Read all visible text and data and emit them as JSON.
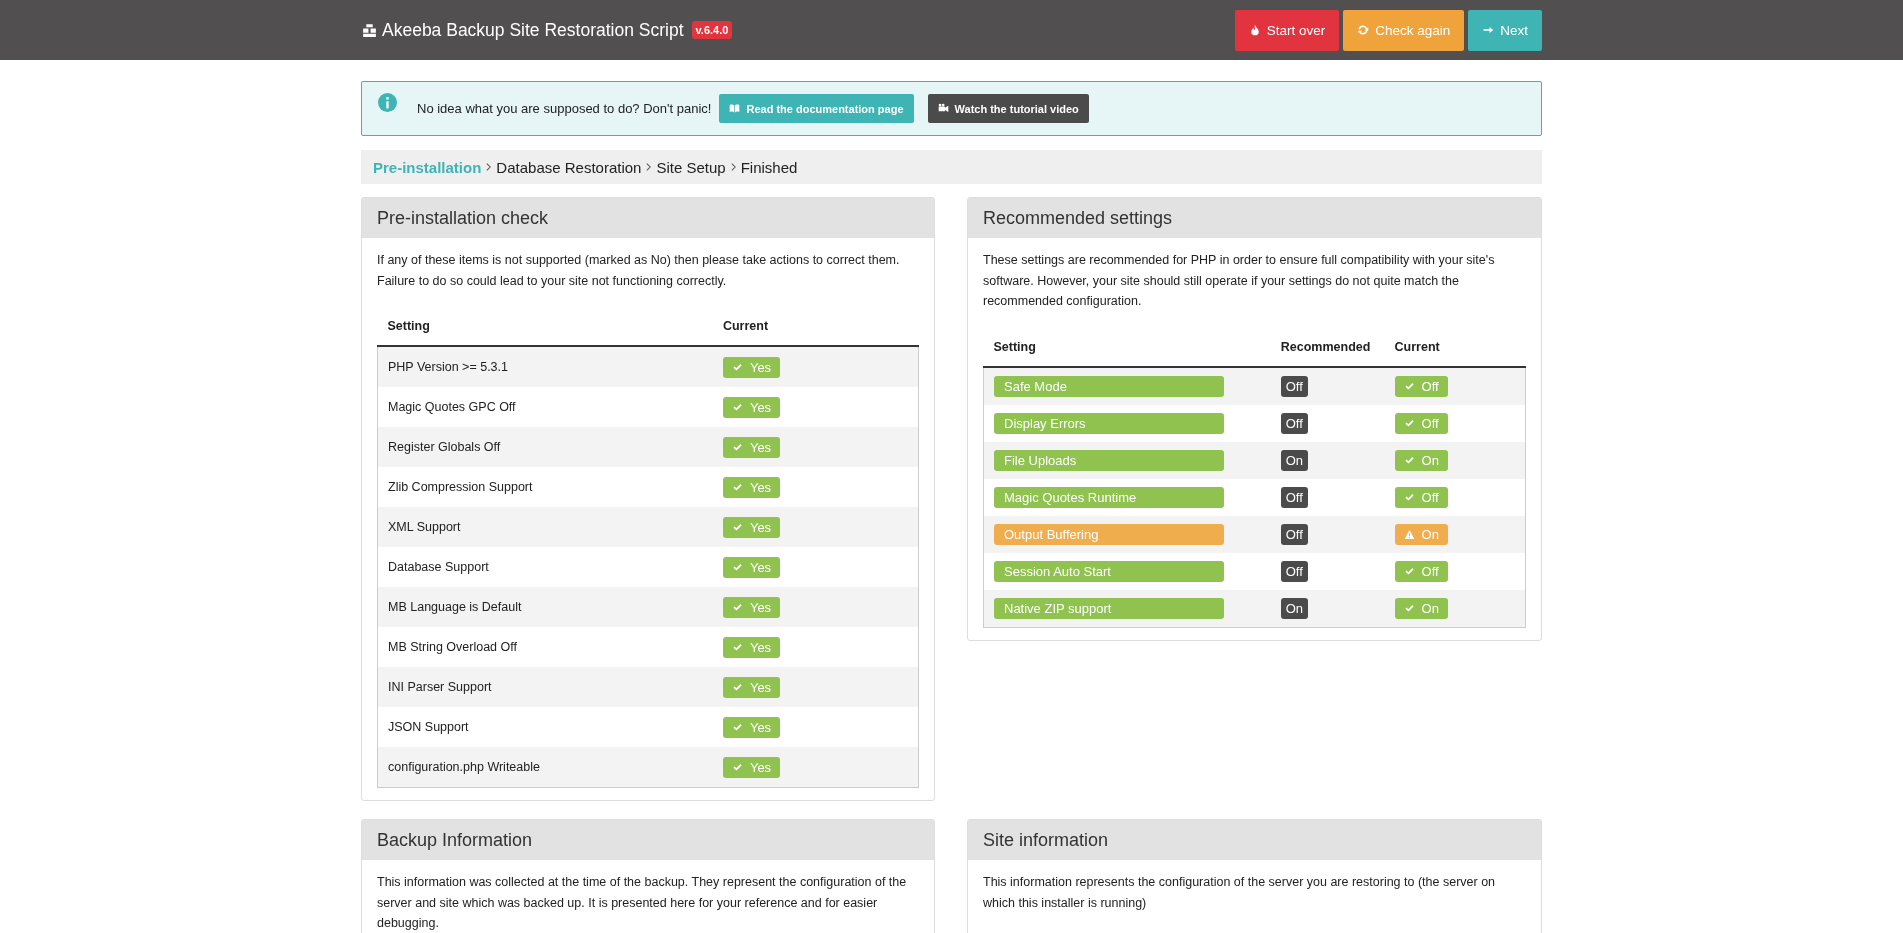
{
  "header": {
    "title": "Akeeba Backup Site Restoration Script",
    "version": "v.6.4.0",
    "buttons": [
      {
        "kind": "danger",
        "label": "Start over"
      },
      {
        "kind": "warning",
        "label": "Check again"
      },
      {
        "kind": "primary",
        "label": "Next"
      }
    ]
  },
  "notice": {
    "text": "No idea what you are supposed to do? Don't panic!",
    "buttons": [
      {
        "kind": "docs",
        "label": "Read the documentation page"
      },
      {
        "kind": "video",
        "label": "Watch the tutorial video"
      }
    ]
  },
  "breadcrumb": [
    {
      "label": "Pre-installation",
      "selected": true
    },
    {
      "label": "Database Restoration",
      "selected": false
    },
    {
      "label": "Site Setup",
      "selected": false
    },
    {
      "label": "Finished",
      "selected": false
    }
  ],
  "preinstall": {
    "title": "Pre-installation check",
    "intro": "If any of these items is not supported (marked as No) then please take actions to correct them. Failure to do so could lead to your site not functioning correctly.",
    "columns": [
      "Setting",
      "Current"
    ],
    "rows": [
      {
        "setting": "PHP Version >= 5.3.1",
        "current": "Yes",
        "kind": "ok"
      },
      {
        "setting": "Magic Quotes GPC Off",
        "current": "Yes",
        "kind": "ok"
      },
      {
        "setting": "Register Globals Off",
        "current": "Yes",
        "kind": "ok"
      },
      {
        "setting": "Zlib Compression Support",
        "current": "Yes",
        "kind": "ok"
      },
      {
        "setting": "XML Support",
        "current": "Yes",
        "kind": "ok"
      },
      {
        "setting": "Database Support",
        "current": "Yes",
        "kind": "ok"
      },
      {
        "setting": "MB Language is Default",
        "current": "Yes",
        "kind": "ok"
      },
      {
        "setting": "MB String Overload Off",
        "current": "Yes",
        "kind": "ok"
      },
      {
        "setting": "INI Parser Support",
        "current": "Yes",
        "kind": "ok"
      },
      {
        "setting": "JSON Support",
        "current": "Yes",
        "kind": "ok"
      },
      {
        "setting": "configuration.php Writeable",
        "current": "Yes",
        "kind": "ok"
      }
    ]
  },
  "recommended": {
    "title": "Recommended settings",
    "intro": "These settings are recommended for PHP in order to ensure full compatibility with your site's software. However, your site should still operate if your settings do not quite match the recommended configuration.",
    "columns": [
      "Setting",
      "Recommended",
      "Current"
    ],
    "rows": [
      {
        "setting": "Safe Mode",
        "recommended": "Off",
        "current": "Off",
        "kind": "ok"
      },
      {
        "setting": "Display Errors",
        "recommended": "Off",
        "current": "Off",
        "kind": "ok"
      },
      {
        "setting": "File Uploads",
        "recommended": "On",
        "current": "On",
        "kind": "ok"
      },
      {
        "setting": "Magic Quotes Runtime",
        "recommended": "Off",
        "current": "Off",
        "kind": "ok"
      },
      {
        "setting": "Output Buffering",
        "recommended": "Off",
        "current": "On",
        "kind": "warning"
      },
      {
        "setting": "Session Auto Start",
        "recommended": "Off",
        "current": "Off",
        "kind": "ok"
      },
      {
        "setting": "Native ZIP support",
        "recommended": "On",
        "current": "On",
        "kind": "ok"
      }
    ]
  },
  "backup_info": {
    "title": "Backup Information",
    "intro": "This information was collected at the time of the backup. They represent the configuration of the server and site which was backed up. It is presented here for your reference and for easier debugging."
  },
  "site_info": {
    "title": "Site information",
    "intro": "This information represents the configuration of the server you are restoring to (the server on which this installer is running)"
  }
}
